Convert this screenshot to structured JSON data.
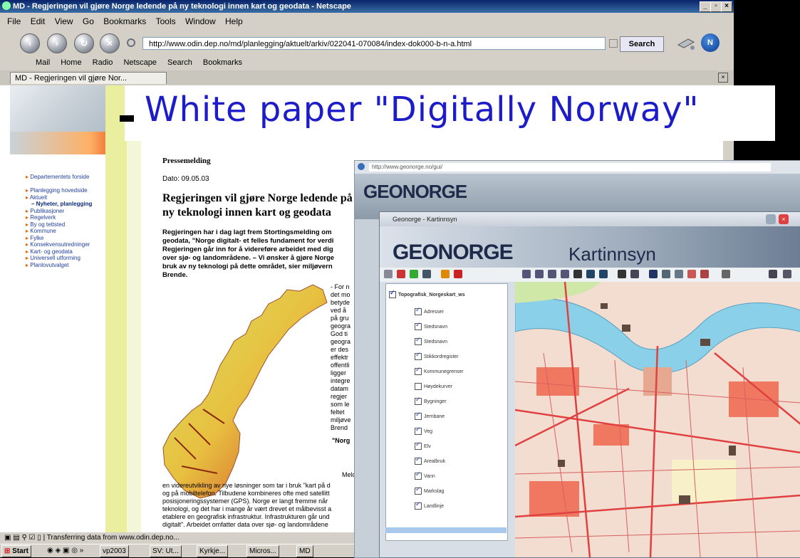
{
  "window": {
    "title": "MD - Regjeringen vil gjøre Norge ledende på ny teknologi innen kart og geodata - Netscape",
    "controls": [
      "_",
      "▫",
      "×"
    ]
  },
  "menu": [
    "File",
    "Edit",
    "View",
    "Go",
    "Bookmarks",
    "Tools",
    "Window",
    "Help"
  ],
  "nav": {
    "url": "http://www.odin.dep.no/md/planlegging/aktuelt/arkiv/022041-070084/index-dok000-b-n-a.html",
    "search_label": "Search"
  },
  "personal_bar": [
    "Mail",
    "Home",
    "Radio",
    "Netscape",
    "Search",
    "Bookmarks"
  ],
  "tab": {
    "label": "MD - Regjeringen vil gjøre Nor..."
  },
  "slide_title": "White paper  \"Digitally Norway\"",
  "sidebar_nav": [
    "Departementets forside",
    "",
    "Planlegging hovedside",
    "Aktuelt",
    "– Nyheter, planlegging",
    "Publikasjoner",
    "Regelverk",
    "By og tettsted",
    "Kommune",
    "Fylke",
    "Konsekvensutredninger",
    "Kart- og geodata",
    "Universell utforming",
    "Planlovutvalget"
  ],
  "article": {
    "label": "Pressemelding",
    "date": "Dato: 09.05.03",
    "headline": "Regjeringen vil gjøre Norge ledende på ny teknologi innen kart og geodata",
    "lead": "Regjeringen har i dag lagt frem Stortingsmelding om\ngeodata, \"Norge digitalt- et felles fundament for verdi\nRegjeringen går inn for å videreføre arbeidet med dig\nover sjø- og landområdene. – Vi ønsker å gjøre Norge\nbruk av ny teknologi på dette området, sier miljøvern\nBrende.",
    "right_col": "- For n\ndet mo\nbetyde\nved å\npå gru\ngeogra\nGod ti\ngeogra\ner des\neffektr\noffentli\nligger\nintegre\ndatam\nregjer\nsom le\nfeltet\nmiljøve\nBrend",
    "subhead": "\"Norg",
    "meld": "Meldir",
    "body": "en videreutvikling av nye løsninger som tar i bruk \"kart på d\nog på mobiltelefon. Tilbudene kombineres ofte med satellitt\nposisjoneringssystemer (GPS). Norge er langt fremme når\nteknologi, og det har i mange år vært drevet et målbevisst a\netablere en geografisk infrastruktur. Infrastrukturen går und\ndigitalt\". Arbeidet omfatter data over sjø- og landområdene"
  },
  "status": {
    "text": "Transferring data from www.odin.dep.no..."
  },
  "taskbar": {
    "start": "Start",
    "items": [
      "vp2003",
      "SV: Ut...",
      "Kyrkje...",
      "Micros...",
      "MD"
    ]
  },
  "geonorge_back": {
    "url": "http://www.geonorge.no/gui/",
    "logo": "GEONORGE"
  },
  "geonorge_front": {
    "title": "Geonorge - Kartinnsyn",
    "logo": "GEONORGE",
    "app_name": "Kartinnsyn",
    "tree_root": "Topografisk_Norgeskart_ws",
    "layers": [
      {
        "label": "Adresser",
        "on": true
      },
      {
        "label": "Stedsnavn",
        "on": true
      },
      {
        "label": "Stedsnavn",
        "on": true
      },
      {
        "label": "Stikkordregister",
        "on": true
      },
      {
        "label": "Kommunegrenser",
        "on": true
      },
      {
        "label": "Høydekurver",
        "on": false
      },
      {
        "label": "Bygninger",
        "on": true
      },
      {
        "label": "Jernbane",
        "on": true
      },
      {
        "label": "Veg",
        "on": true
      },
      {
        "label": "Elv",
        "on": true
      },
      {
        "label": "Arealbruk",
        "on": true
      },
      {
        "label": "Vann",
        "on": true
      },
      {
        "label": "Markslag",
        "on": true
      },
      {
        "label": "Landlinje",
        "on": true
      }
    ]
  },
  "colors": {
    "title_blue": "#1c1cc8",
    "nav_link": "#1f3fa0",
    "titlebar": "#0a246a"
  }
}
